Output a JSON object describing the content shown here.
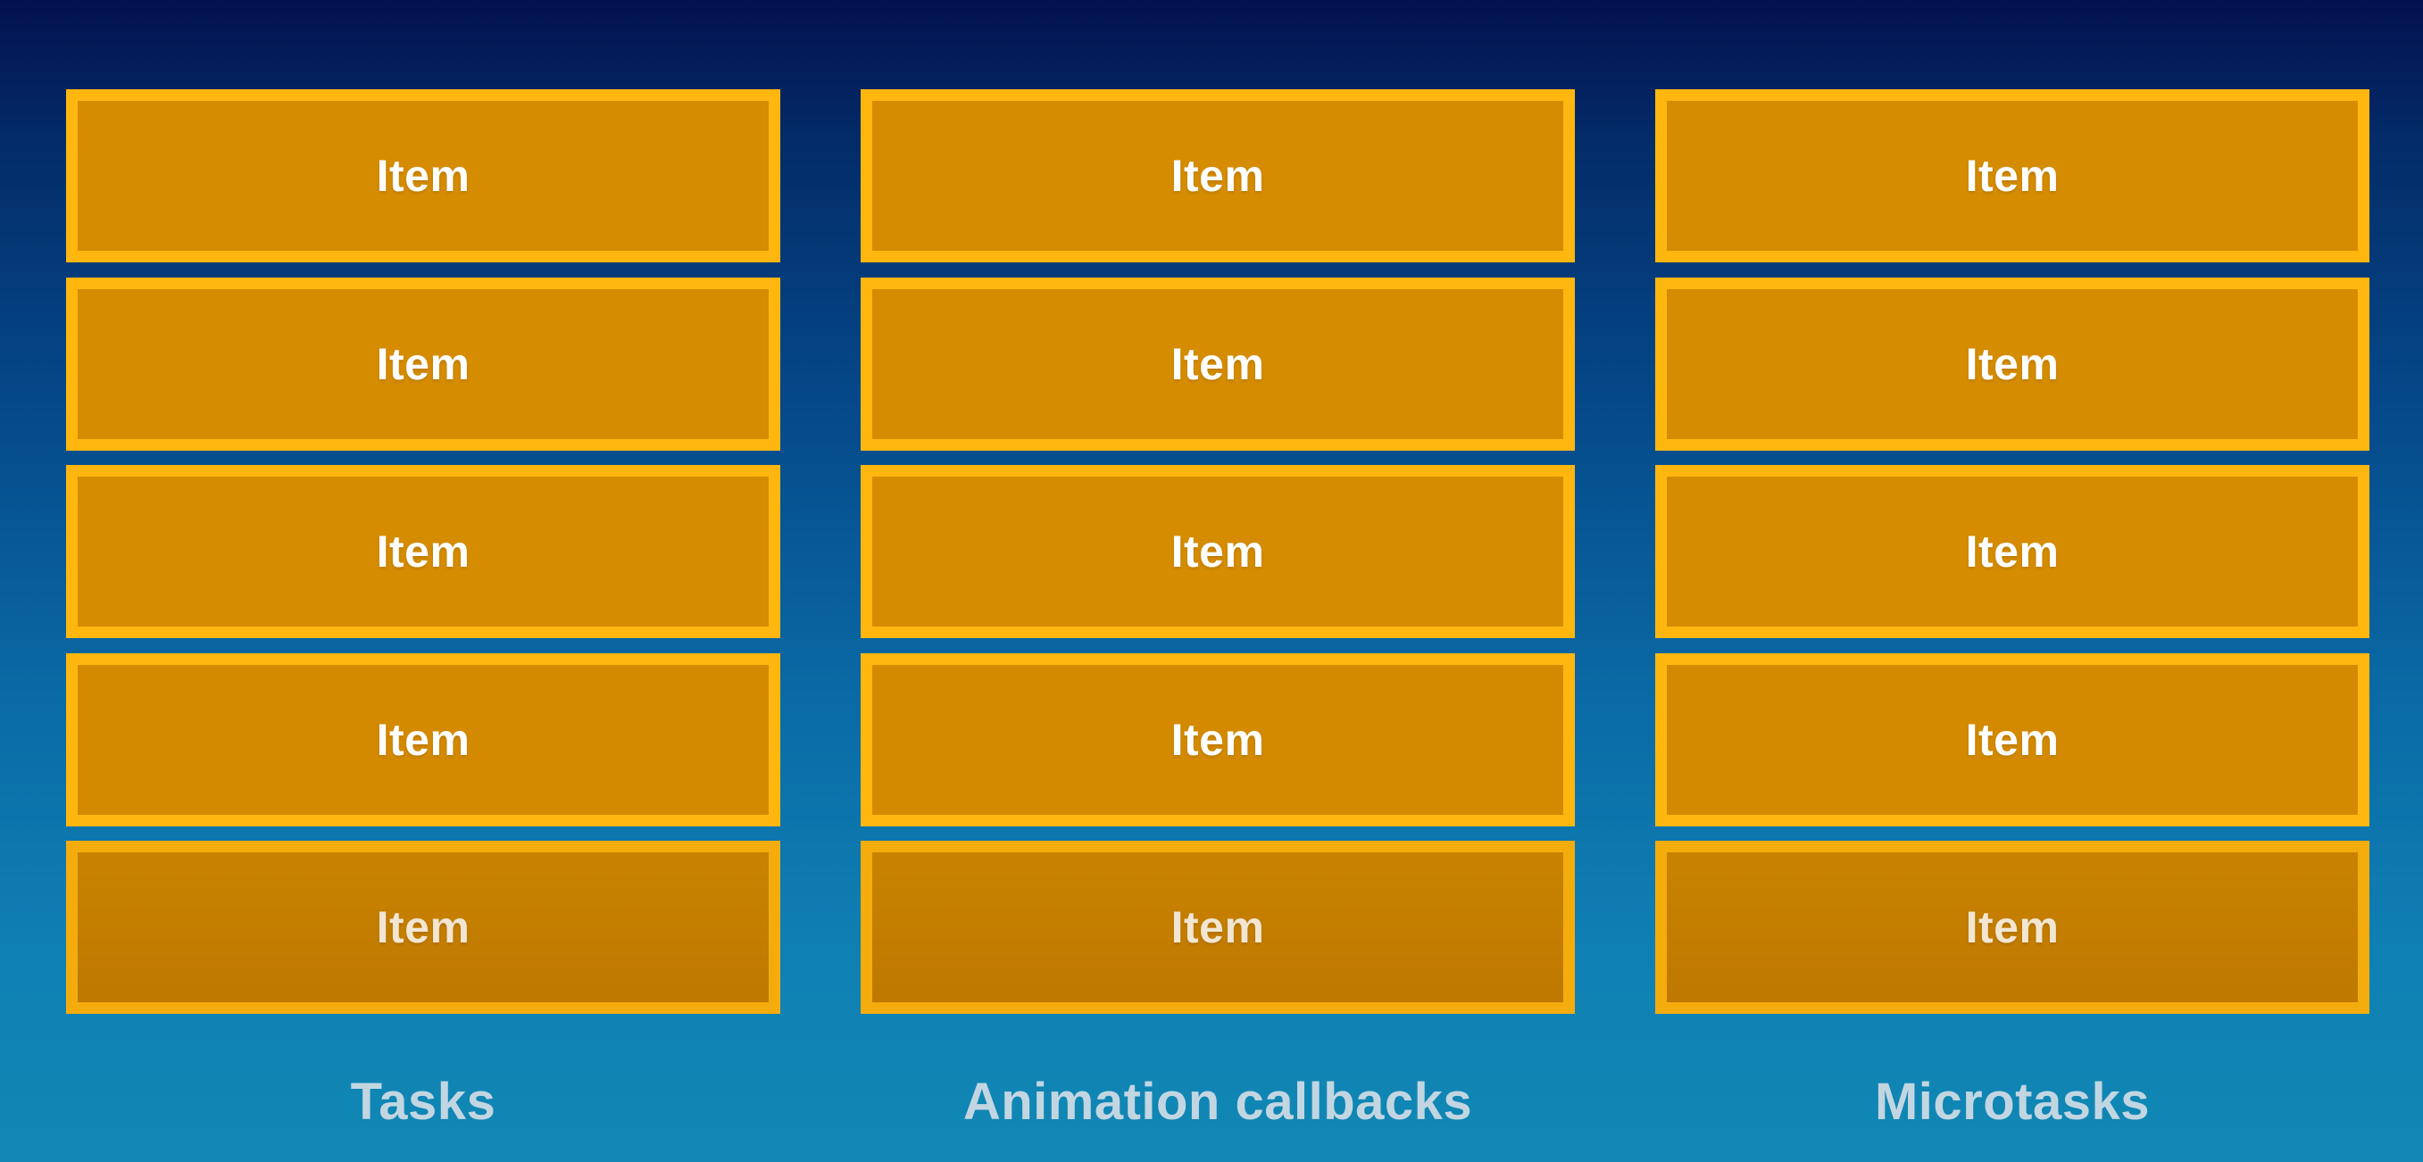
{
  "columns": [
    {
      "label": "Tasks",
      "items": [
        "Item",
        "Item",
        "Item",
        "Item",
        "Item"
      ]
    },
    {
      "label": "Animation callbacks",
      "items": [
        "Item",
        "Item",
        "Item",
        "Item",
        "Item"
      ]
    },
    {
      "label": "Microtasks",
      "items": [
        "Item",
        "Item",
        "Item",
        "Item",
        "Item"
      ]
    }
  ],
  "colors": {
    "item_fill": "#d58c00",
    "item_border": "#ffb70f",
    "item_text": "#ffffff",
    "label_text": "#c2d6e2",
    "background_top": "#03114f",
    "background_bottom": "#1188b4"
  }
}
